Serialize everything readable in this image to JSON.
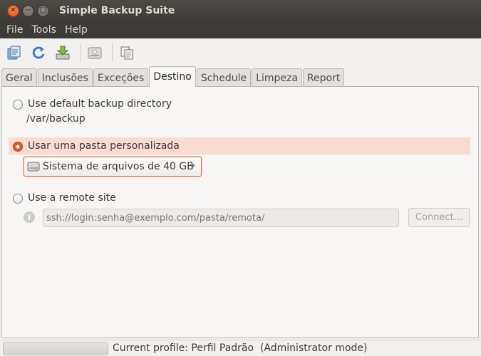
{
  "window": {
    "title": "Simple Backup Suite"
  },
  "menu": [
    "File",
    "Tools",
    "Help"
  ],
  "toolbar": {
    "icons": [
      "save-config-icon",
      "refresh-icon",
      "backup-now-icon",
      "restore-icon",
      "copy-profile-icon"
    ]
  },
  "tabs": [
    {
      "label": "Geral"
    },
    {
      "label": "Inclusões"
    },
    {
      "label": "Exceções"
    },
    {
      "label": "Destino",
      "active": true
    },
    {
      "label": "Schedule"
    },
    {
      "label": "Limpeza"
    },
    {
      "label": "Report"
    }
  ],
  "destination": {
    "default_option": {
      "label": "Use default backup directory",
      "path": "/var/backup",
      "selected": false
    },
    "custom_option": {
      "label": "Usar uma pasta personalizada",
      "selected": true,
      "folder_value": "Sistema de arquivos de 40 GB"
    },
    "remote_option": {
      "label": "Use a remote site",
      "selected": false,
      "url_placeholder": "ssh://login:senha@exemplo.com/pasta/remota/",
      "connect_label": "Connect..."
    }
  },
  "status": {
    "progress_fraction": 0,
    "text": "Current profile: Perfil Padrão  (Administrator mode)"
  },
  "colors": {
    "accent": "#dd4814",
    "selected_row": "#f9dbd0",
    "titlebar": "#3c3b37"
  }
}
